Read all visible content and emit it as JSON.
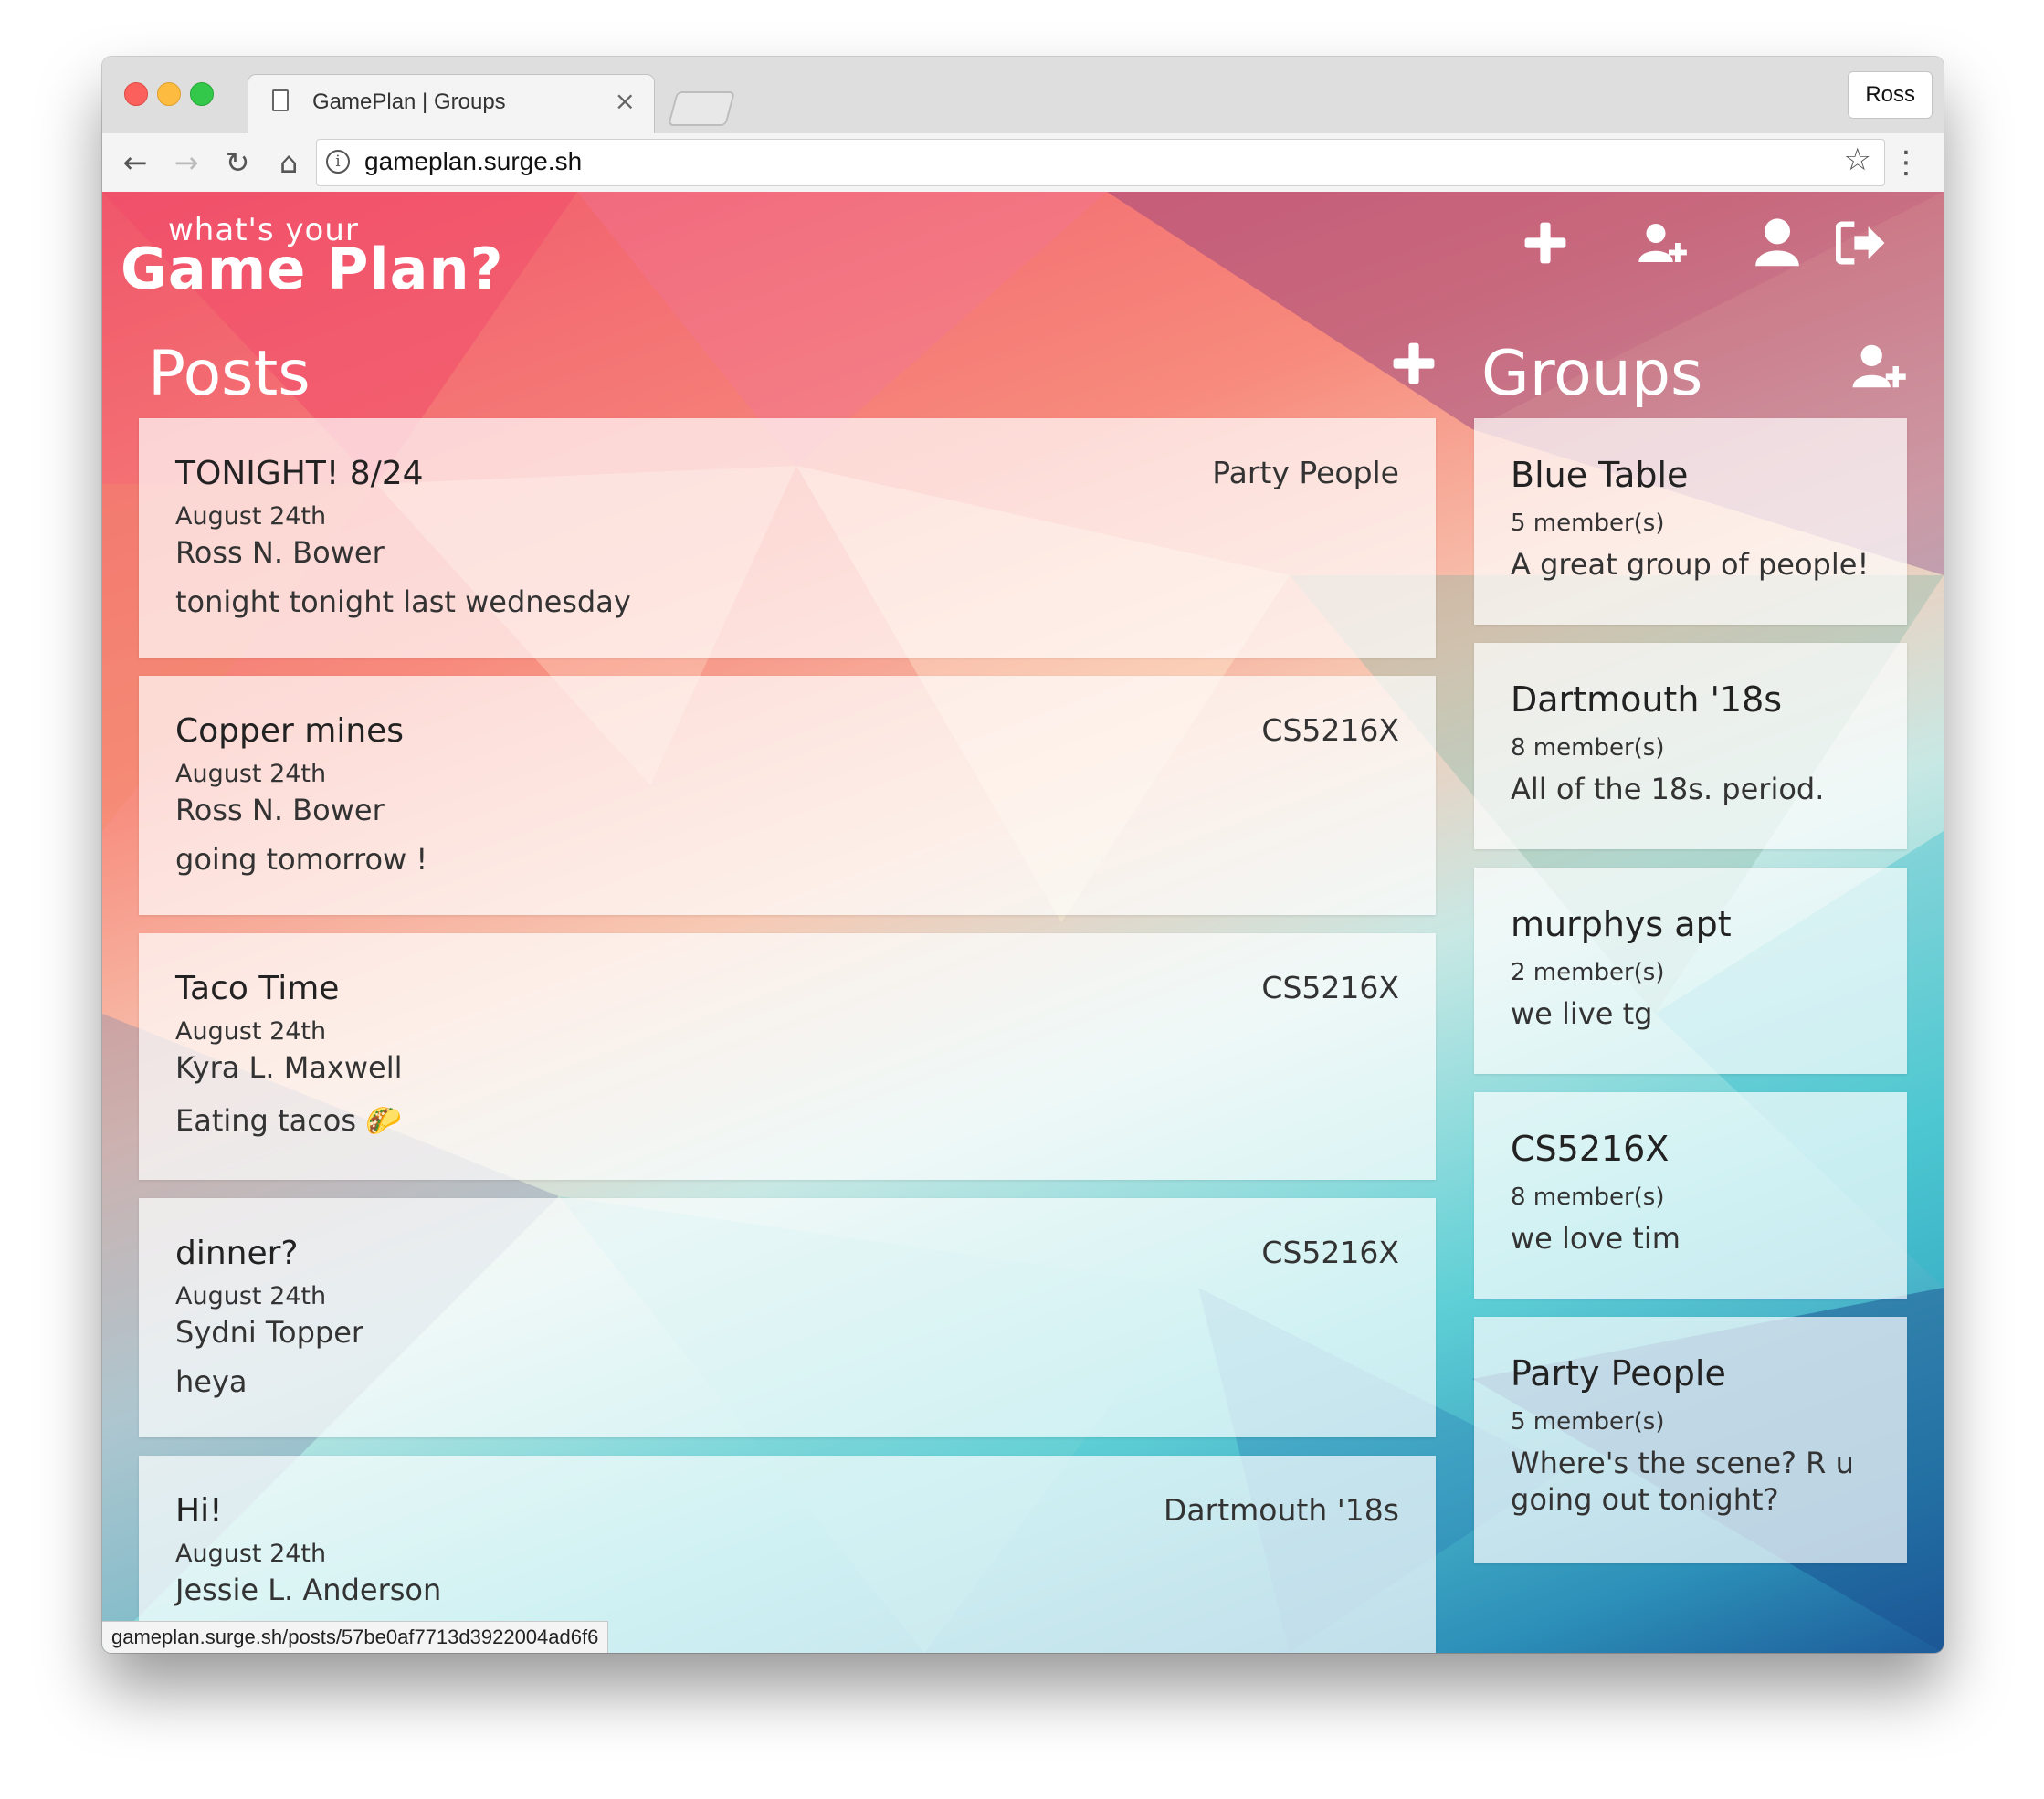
{
  "browser": {
    "tab_title": "GamePlan | Groups",
    "tab_close": "×",
    "profile_name": "Ross",
    "url": "gameplan.surge.sh",
    "status_url": "gameplan.surge.sh/posts/57be0af7713d3922004ad6f6"
  },
  "header": {
    "logo_small": "what's your",
    "logo_big": "Game Plan?",
    "icons": [
      "plus-icon",
      "add-user-icon",
      "user-icon",
      "sign-out-icon"
    ]
  },
  "posts": {
    "title": "Posts",
    "items": [
      {
        "title": "TONIGHT! 8/24",
        "group": "Party People",
        "date": "August 24th",
        "author": "Ross N. Bower",
        "body": "tonight tonight last wednesday"
      },
      {
        "title": "Copper mines",
        "group": "CS5216X",
        "date": "August 24th",
        "author": "Ross N. Bower",
        "body": "going tomorrow !"
      },
      {
        "title": "Taco Time",
        "group": "CS5216X",
        "date": "August 24th",
        "author": "Kyra L. Maxwell",
        "body": "Eating tacos 🌮"
      },
      {
        "title": "dinner?",
        "group": "CS5216X",
        "date": "August 24th",
        "author": "Sydni Topper",
        "body": "heya"
      },
      {
        "title": "Hi!",
        "group": "Dartmouth '18s",
        "date": "August 24th",
        "author": "Jessie L. Anderson",
        "body": ""
      }
    ]
  },
  "groups": {
    "title": "Groups",
    "items": [
      {
        "name": "Blue Table",
        "members": "5 member(s)",
        "description": "A great group of people!"
      },
      {
        "name": "Dartmouth '18s",
        "members": "8 member(s)",
        "description": "All of the 18s. period."
      },
      {
        "name": "murphys apt",
        "members": "2 member(s)",
        "description": "we live tg"
      },
      {
        "name": "CS5216X",
        "members": "8 member(s)",
        "description": "we love tim"
      },
      {
        "name": "Party People",
        "members": "5 member(s)",
        "description": "Where's the scene? R u going out tonight?"
      }
    ]
  },
  "colors": {
    "bg_top_left": "#f0566a",
    "bg_middle": "#f7c9b4",
    "bg_bottom_right": "#1d5c9a",
    "card_bg": "rgba(255,255,255,0.70)"
  }
}
